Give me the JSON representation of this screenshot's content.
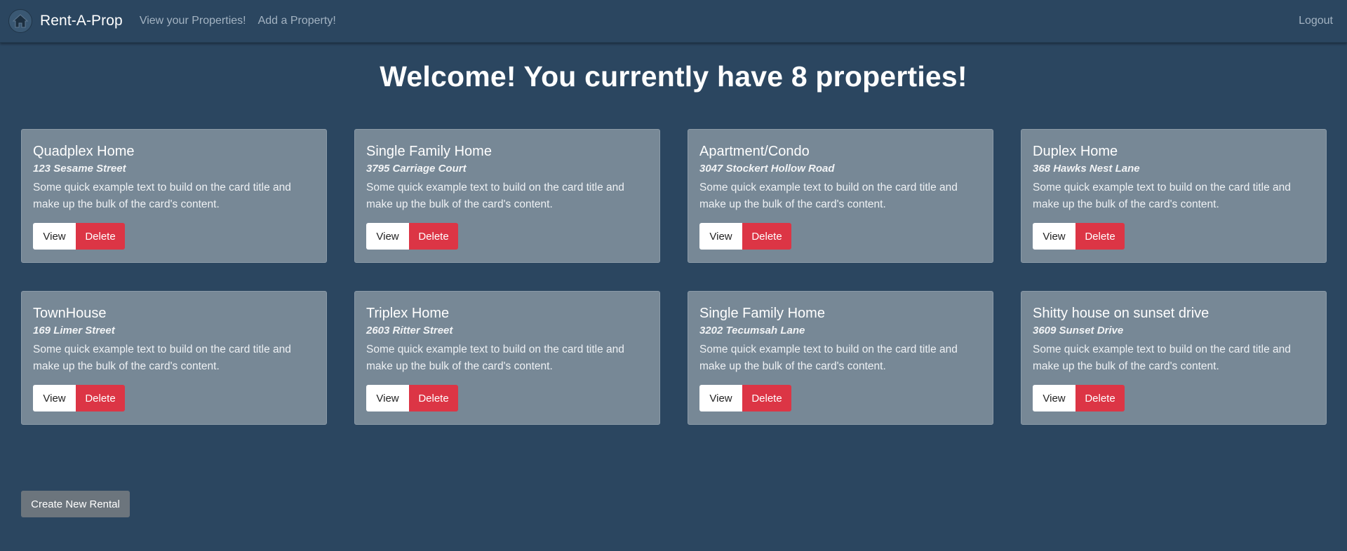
{
  "nav": {
    "brand": "Rent-A-Prop",
    "links": [
      "View your Properties!",
      "Add a Property!"
    ],
    "logout": "Logout",
    "logo_icon": "house-icon"
  },
  "heading": "Welcome! You currently have 8 properties!",
  "cards": [
    {
      "title": "Quadplex Home",
      "address": "123 Sesame Street",
      "text": "Some quick example text to build on the card title and make up the bulk of the card's content.",
      "view": "View",
      "delete": "Delete"
    },
    {
      "title": "Single Family Home",
      "address": "3795 Carriage Court",
      "text": "Some quick example text to build on the card title and make up the bulk of the card's content.",
      "view": "View",
      "delete": "Delete"
    },
    {
      "title": "Apartment/Condo",
      "address": "3047 Stockert Hollow Road",
      "text": "Some quick example text to build on the card title and make up the bulk of the card's content.",
      "view": "View",
      "delete": "Delete"
    },
    {
      "title": "Duplex Home",
      "address": "368 Hawks Nest Lane",
      "text": "Some quick example text to build on the card title and make up the bulk of the card's content.",
      "view": "View",
      "delete": "Delete"
    },
    {
      "title": "TownHouse",
      "address": "169 Limer Street",
      "text": "Some quick example text to build on the card title and make up the bulk of the card's content.",
      "view": "View",
      "delete": "Delete"
    },
    {
      "title": "Triplex Home",
      "address": "2603 Ritter Street",
      "text": "Some quick example text to build on the card title and make up the bulk of the card's content.",
      "view": "View",
      "delete": "Delete"
    },
    {
      "title": "Single Family Home",
      "address": "3202 Tecumsah Lane",
      "text": "Some quick example text to build on the card title and make up the bulk of the card's content.",
      "view": "View",
      "delete": "Delete"
    },
    {
      "title": "Shitty house on sunset drive",
      "address": "3609 Sunset Drive",
      "text": "Some quick example text to build on the card title and make up the bulk of the card's content.",
      "view": "View",
      "delete": "Delete"
    }
  ],
  "create_button": "Create New Rental",
  "colors": {
    "background": "#2b4660",
    "card": "#778896",
    "delete": "#dc3545",
    "create": "#6c757d"
  }
}
